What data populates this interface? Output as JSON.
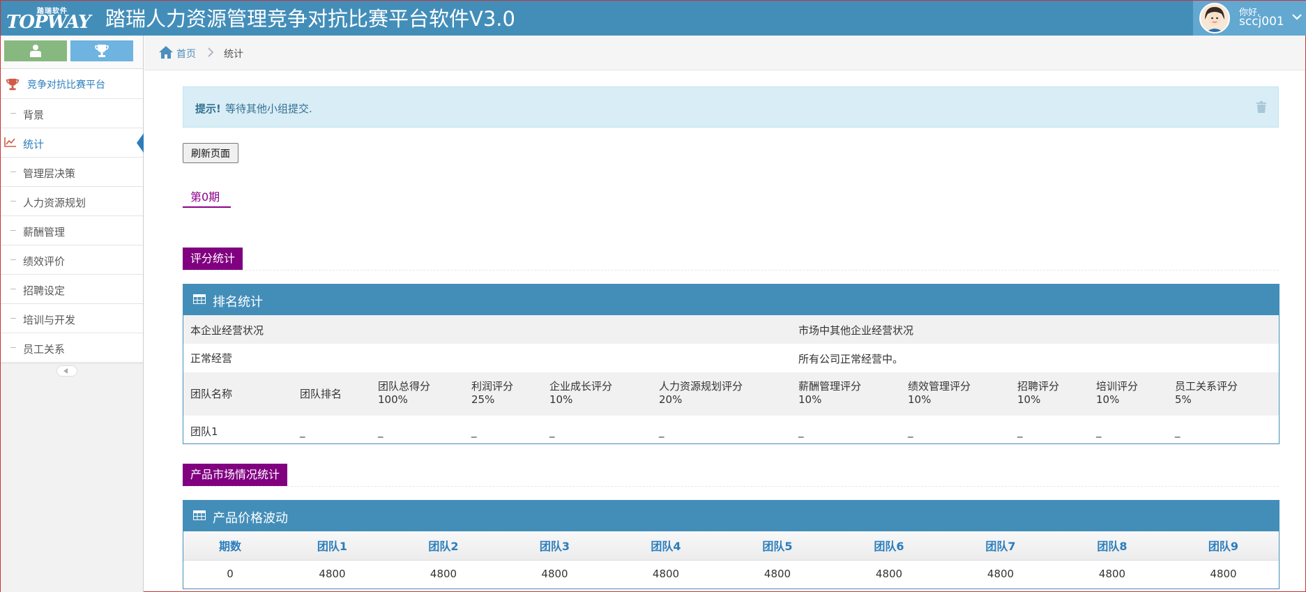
{
  "header": {
    "logo_top": "踏瑞软件",
    "logo_main": "TOPWAY",
    "title": "踏瑞人力资源管理竞争对抗比赛平台软件V3.0",
    "user_greeting": "你好,",
    "user_name": "sccj001"
  },
  "sidebar": {
    "section_title": "竞争对抗比赛平台",
    "items": [
      {
        "label": "背景"
      },
      {
        "label": "统计"
      },
      {
        "label": "管理层决策"
      },
      {
        "label": "人力资源规划"
      },
      {
        "label": "薪酬管理"
      },
      {
        "label": "绩效评价"
      },
      {
        "label": "招聘设定"
      },
      {
        "label": "培训与开发"
      },
      {
        "label": "员工关系"
      }
    ]
  },
  "breadcrumb": {
    "home": "首页",
    "current": "统计"
  },
  "alert": {
    "strong": "提示!",
    "message": "等待其他小组提交."
  },
  "refresh_label": "刷新页面",
  "period_tab": "第0期",
  "score_section": {
    "label": "评分统计",
    "panel_title": "排名统计",
    "own_status_label": "本企业经营状况",
    "market_status_label": "市场中其他企业经营状况",
    "own_status_value": "正常经营",
    "market_status_value": "所有公司正常经营中。",
    "columns": [
      {
        "name": "团队名称",
        "weight": ""
      },
      {
        "name": "团队排名",
        "weight": ""
      },
      {
        "name": "团队总得分",
        "weight": "100%"
      },
      {
        "name": "利润评分",
        "weight": "25%"
      },
      {
        "name": "企业成长评分",
        "weight": "10%"
      },
      {
        "name": "人力资源规划评分",
        "weight": "20%"
      },
      {
        "name": "薪酬管理评分",
        "weight": "10%"
      },
      {
        "name": "绩效管理评分",
        "weight": "10%"
      },
      {
        "name": "招聘评分",
        "weight": "10%"
      },
      {
        "name": "培训评分",
        "weight": "10%"
      },
      {
        "name": "员工关系评分",
        "weight": "5%"
      }
    ],
    "rows": [
      [
        "团队1",
        "_",
        "_",
        "_",
        "_",
        "_",
        "_",
        "_",
        "_",
        "_",
        "_"
      ]
    ]
  },
  "market_section": {
    "label": "产品市场情况统计",
    "panel_title": "产品价格波动",
    "headers": [
      "期数",
      "团队1",
      "团队2",
      "团队3",
      "团队4",
      "团队5",
      "团队6",
      "团队7",
      "团队8",
      "团队9"
    ],
    "rows": [
      [
        "0",
        "4800",
        "4800",
        "4800",
        "4800",
        "4800",
        "4800",
        "4800",
        "4800",
        "4800"
      ]
    ]
  },
  "colors": {
    "brand_blue": "#438eb9",
    "section_purple": "#800080",
    "status_green": "#1a9a1a"
  }
}
